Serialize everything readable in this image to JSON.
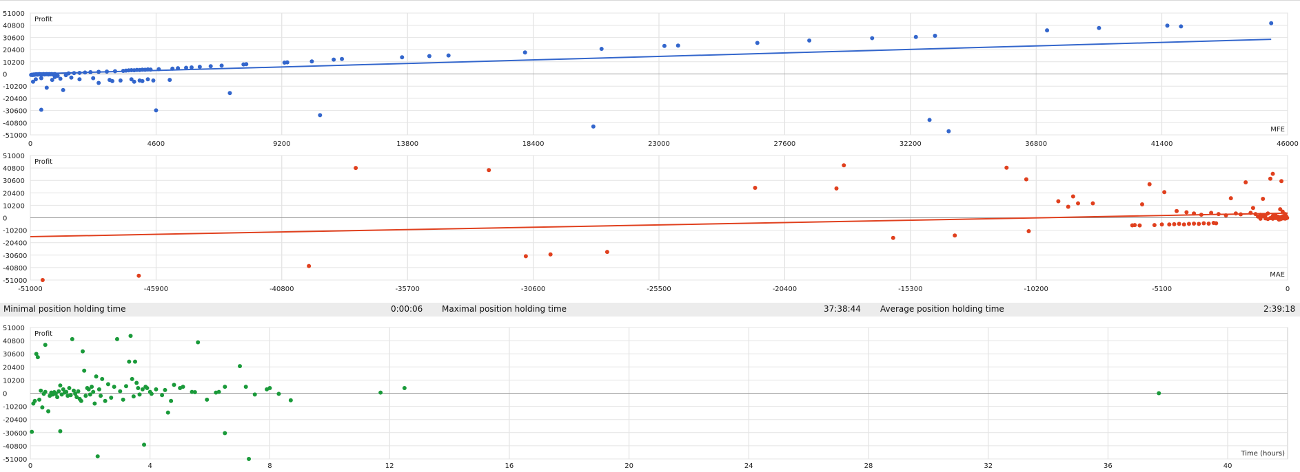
{
  "chart_data": [
    {
      "type": "scatter",
      "ylabel": "Profit",
      "xlabel": "MFE",
      "color": "#3366cc",
      "xlim": [
        0,
        46000
      ],
      "ylim": [
        -51000,
        51000
      ],
      "xticks": [
        0,
        4600,
        9200,
        13800,
        18400,
        23000,
        27600,
        32200,
        36800,
        41400,
        46000
      ],
      "yticks": [
        51000,
        40800,
        30600,
        20400,
        10200,
        0,
        -10200,
        -20400,
        -30600,
        -40800,
        -51000
      ],
      "grid": true,
      "trendline": {
        "x": [
          0,
          45400
        ],
        "y": [
          0,
          29000
        ]
      },
      "points": [
        [
          30,
          -800
        ],
        [
          60,
          -600
        ],
        [
          90,
          -900
        ],
        [
          120,
          -400
        ],
        [
          150,
          -700
        ],
        [
          180,
          -300
        ],
        [
          210,
          -500
        ],
        [
          240,
          -200
        ],
        [
          270,
          -600
        ],
        [
          300,
          -300
        ],
        [
          330,
          -100
        ],
        [
          360,
          -400
        ],
        [
          390,
          -200
        ],
        [
          420,
          -500
        ],
        [
          450,
          -300
        ],
        [
          480,
          -100
        ],
        [
          510,
          -400
        ],
        [
          540,
          -200
        ],
        [
          570,
          -300
        ],
        [
          600,
          -100
        ],
        [
          630,
          -200
        ],
        [
          660,
          -400
        ],
        [
          690,
          -100
        ],
        [
          720,
          -300
        ],
        [
          750,
          -200
        ],
        [
          780,
          -100
        ],
        [
          810,
          -300
        ],
        [
          840,
          -500
        ],
        [
          870,
          -200
        ],
        [
          900,
          -100
        ],
        [
          100,
          -6500
        ],
        [
          200,
          -4500
        ],
        [
          400,
          -3500
        ],
        [
          600,
          -11500
        ],
        [
          800,
          -5000
        ],
        [
          900,
          -2500
        ],
        [
          1000,
          -1500
        ],
        [
          1100,
          -4000
        ],
        [
          1200,
          -13500
        ],
        [
          1300,
          -1000
        ],
        [
          400,
          -30000
        ],
        [
          1400,
          500
        ],
        [
          1600,
          700
        ],
        [
          1800,
          900
        ],
        [
          2000,
          1200
        ],
        [
          2200,
          1500
        ],
        [
          2500,
          1800
        ],
        [
          2800,
          2000
        ],
        [
          3100,
          2300
        ],
        [
          3400,
          2600
        ],
        [
          1500,
          -3000
        ],
        [
          1800,
          -4500
        ],
        [
          2300,
          -3500
        ],
        [
          2500,
          -7500
        ],
        [
          2900,
          -5000
        ],
        [
          3000,
          -6000
        ],
        [
          3300,
          -5500
        ],
        [
          3700,
          -4500
        ],
        [
          3800,
          -6500
        ],
        [
          4000,
          -5500
        ],
        [
          3500,
          2800
        ],
        [
          3600,
          3000
        ],
        [
          3700,
          3200
        ],
        [
          3800,
          3100
        ],
        [
          3900,
          3400
        ],
        [
          4000,
          3300
        ],
        [
          4100,
          3600
        ],
        [
          4200,
          3500
        ],
        [
          4300,
          3800
        ],
        [
          4400,
          3700
        ],
        [
          4100,
          -6000
        ],
        [
          4300,
          -4500
        ],
        [
          4500,
          -5500
        ],
        [
          4600,
          -30500
        ],
        [
          4700,
          4000
        ],
        [
          5100,
          -5000
        ],
        [
          5200,
          4500
        ],
        [
          5400,
          4800
        ],
        [
          5700,
          5200
        ],
        [
          5900,
          5500
        ],
        [
          6200,
          6000
        ],
        [
          6600,
          6500
        ],
        [
          7000,
          7000
        ],
        [
          7300,
          -16000
        ],
        [
          7800,
          8000
        ],
        [
          7900,
          8200
        ],
        [
          9300,
          9500
        ],
        [
          9400,
          9700
        ],
        [
          10300,
          10500
        ],
        [
          10600,
          -34500
        ],
        [
          11100,
          12000
        ],
        [
          11400,
          12500
        ],
        [
          13600,
          14000
        ],
        [
          14600,
          15000
        ],
        [
          15300,
          15500
        ],
        [
          18100,
          18000
        ],
        [
          20600,
          -44000
        ],
        [
          20900,
          21000
        ],
        [
          23200,
          23500
        ],
        [
          23700,
          23800
        ],
        [
          26600,
          26000
        ],
        [
          28500,
          28000
        ],
        [
          30800,
          30000
        ],
        [
          32400,
          31000
        ],
        [
          32900,
          -38500
        ],
        [
          33100,
          32000
        ],
        [
          33600,
          -48000
        ],
        [
          37200,
          36500
        ],
        [
          39100,
          38500
        ],
        [
          41600,
          40500
        ],
        [
          42100,
          39800
        ],
        [
          45400,
          42500
        ]
      ]
    },
    {
      "type": "scatter",
      "ylabel": "Profit",
      "xlabel": "MAE",
      "color": "#e0401e",
      "xlim": [
        -51000,
        0
      ],
      "ylim": [
        -51000,
        51000
      ],
      "xticks": [
        -51000,
        -45900,
        -40800,
        -35700,
        -30600,
        -25500,
        -20400,
        -15300,
        -10200,
        -5100,
        0
      ],
      "yticks": [
        51000,
        40800,
        30600,
        20400,
        10200,
        0,
        -10200,
        -20400,
        -30600,
        -40800,
        -51000
      ],
      "grid": true,
      "trendline": {
        "x": [
          -51000,
          0
        ],
        "y": [
          -15500,
          3800
        ]
      },
      "points": [
        [
          -50500,
          -51000
        ],
        [
          -46600,
          -47500
        ],
        [
          -39700,
          -39500
        ],
        [
          -37800,
          40800
        ],
        [
          -32400,
          39000
        ],
        [
          -30900,
          -31500
        ],
        [
          -29900,
          -30000
        ],
        [
          -27600,
          -28000
        ],
        [
          -21600,
          24500
        ],
        [
          -18300,
          24000
        ],
        [
          -18000,
          43000
        ],
        [
          -16000,
          -16500
        ],
        [
          -13500,
          -14500
        ],
        [
          -11400,
          41000
        ],
        [
          -10600,
          31500
        ],
        [
          -10500,
          -11000
        ],
        [
          -9300,
          13500
        ],
        [
          -8900,
          9000
        ],
        [
          -8700,
          17500
        ],
        [
          -8500,
          11800
        ],
        [
          -7900,
          11800
        ],
        [
          -6300,
          -6200
        ],
        [
          -6200,
          -6000
        ],
        [
          -6000,
          -6300
        ],
        [
          -5900,
          11000
        ],
        [
          -5600,
          27500
        ],
        [
          -5400,
          -6000
        ],
        [
          -5100,
          -5500
        ],
        [
          -5000,
          21000
        ],
        [
          -4800,
          -5500
        ],
        [
          -4600,
          -5300
        ],
        [
          -4400,
          -5000
        ],
        [
          -4200,
          -5500
        ],
        [
          -4000,
          -5000
        ],
        [
          -3800,
          -4800
        ],
        [
          -3600,
          -5000
        ],
        [
          -3400,
          -4500
        ],
        [
          -3200,
          -4800
        ],
        [
          -3000,
          -4200
        ],
        [
          -2900,
          -4500
        ],
        [
          -4500,
          5500
        ],
        [
          -4100,
          4500
        ],
        [
          -3800,
          3500
        ],
        [
          -3500,
          2500
        ],
        [
          -3100,
          4000
        ],
        [
          -2800,
          3000
        ],
        [
          -2500,
          2000
        ],
        [
          -2300,
          16000
        ],
        [
          -2100,
          3500
        ],
        [
          -1900,
          2800
        ],
        [
          -1700,
          29000
        ],
        [
          -1500,
          4000
        ],
        [
          -1300,
          3000
        ],
        [
          -1100,
          2500
        ],
        [
          -1000,
          15500
        ],
        [
          -900,
          2000
        ],
        [
          -800,
          3500
        ],
        [
          -700,
          32000
        ],
        [
          -600,
          1500
        ],
        [
          -500,
          2500
        ],
        [
          -400,
          1000
        ],
        [
          -350,
          -1500
        ],
        [
          -300,
          500
        ],
        [
          -250,
          -800
        ],
        [
          -200,
          1200
        ],
        [
          -150,
          -500
        ],
        [
          -100,
          800
        ],
        [
          -50,
          -200
        ],
        [
          -900,
          -500
        ],
        [
          -800,
          -1000
        ],
        [
          -700,
          -300
        ],
        [
          -600,
          -800
        ],
        [
          -500,
          -200
        ],
        [
          -400,
          -600
        ],
        [
          -300,
          -1200
        ],
        [
          -200,
          -300
        ],
        [
          -150,
          400
        ],
        [
          -100,
          -700
        ],
        [
          -80,
          200
        ],
        [
          -60,
          -400
        ],
        [
          -40,
          300
        ],
        [
          -20,
          -100
        ],
        [
          -1200,
          1000
        ],
        [
          -1100,
          -800
        ],
        [
          -1000,
          1500
        ],
        [
          -600,
          36000
        ],
        [
          -300,
          7000
        ],
        [
          -200,
          5000
        ],
        [
          -100,
          3000
        ],
        [
          -50,
          1000
        ],
        [
          -250,
          30000
        ],
        [
          -1400,
          8000
        ]
      ]
    },
    {
      "type": "scatter",
      "ylabel": "Profit",
      "xlabel": "Time (hours)",
      "color": "#1a9a3a",
      "xlim": [
        0,
        42
      ],
      "ylim": [
        -51000,
        51000
      ],
      "xticks": [
        0,
        4,
        8,
        12,
        16,
        20,
        24,
        28,
        32,
        36,
        40
      ],
      "yticks": [
        51000,
        40800,
        30600,
        20400,
        10200,
        0,
        -10200,
        -20400,
        -30600,
        -40800,
        -51000
      ],
      "grid": true,
      "points": [
        [
          0.05,
          -30000
        ],
        [
          0.1,
          -8000
        ],
        [
          0.15,
          -6000
        ],
        [
          0.2,
          30500
        ],
        [
          0.25,
          28000
        ],
        [
          0.3,
          -5000
        ],
        [
          0.35,
          2000
        ],
        [
          0.4,
          -11000
        ],
        [
          0.45,
          -500
        ],
        [
          0.5,
          37500
        ],
        [
          0.5,
          1000
        ],
        [
          0.6,
          -14000
        ],
        [
          0.65,
          -2000
        ],
        [
          0.7,
          500
        ],
        [
          0.75,
          -1000
        ],
        [
          0.8,
          800
        ],
        [
          0.85,
          -500
        ],
        [
          0.9,
          -3000
        ],
        [
          0.95,
          1500
        ],
        [
          1.0,
          -29500
        ],
        [
          1.0,
          6000
        ],
        [
          1.05,
          -1000
        ],
        [
          1.1,
          3000
        ],
        [
          1.15,
          500
        ],
        [
          1.2,
          1000
        ],
        [
          1.25,
          -2000
        ],
        [
          1.3,
          4000
        ],
        [
          1.35,
          -1500
        ],
        [
          1.4,
          42000
        ],
        [
          1.45,
          2000
        ],
        [
          1.5,
          -500
        ],
        [
          1.55,
          -3000
        ],
        [
          1.6,
          1500
        ],
        [
          1.65,
          -4500
        ],
        [
          1.7,
          -6000
        ],
        [
          1.75,
          32500
        ],
        [
          1.8,
          17500
        ],
        [
          1.85,
          -2000
        ],
        [
          1.9,
          4000
        ],
        [
          1.95,
          3000
        ],
        [
          2.0,
          -1000
        ],
        [
          2.05,
          5000
        ],
        [
          2.1,
          1000
        ],
        [
          2.15,
          -8000
        ],
        [
          2.2,
          13000
        ],
        [
          2.25,
          -49000
        ],
        [
          2.3,
          3000
        ],
        [
          2.35,
          -2000
        ],
        [
          2.4,
          11000
        ],
        [
          2.5,
          -6000
        ],
        [
          2.6,
          7000
        ],
        [
          2.7,
          -3500
        ],
        [
          2.8,
          5000
        ],
        [
          2.9,
          42000
        ],
        [
          3.0,
          1500
        ],
        [
          3.1,
          -5000
        ],
        [
          3.2,
          5500
        ],
        [
          3.3,
          24500
        ],
        [
          3.35,
          44500
        ],
        [
          3.4,
          11000
        ],
        [
          3.45,
          -2500
        ],
        [
          3.5,
          24500
        ],
        [
          3.55,
          8000
        ],
        [
          3.6,
          4000
        ],
        [
          3.65,
          -1000
        ],
        [
          3.75,
          3000
        ],
        [
          3.8,
          -40000
        ],
        [
          3.85,
          5000
        ],
        [
          3.9,
          4000
        ],
        [
          4.0,
          1000
        ],
        [
          4.05,
          -500
        ],
        [
          4.2,
          3000
        ],
        [
          4.4,
          -1500
        ],
        [
          4.5,
          2500
        ],
        [
          4.6,
          -15000
        ],
        [
          4.7,
          -6000
        ],
        [
          4.8,
          6500
        ],
        [
          5.0,
          4000
        ],
        [
          5.1,
          5000
        ],
        [
          5.4,
          1000
        ],
        [
          5.5,
          800
        ],
        [
          5.6,
          39500
        ],
        [
          5.9,
          -5000
        ],
        [
          6.2,
          500
        ],
        [
          6.3,
          1000
        ],
        [
          6.5,
          -31000
        ],
        [
          6.5,
          5000
        ],
        [
          7.0,
          21000
        ],
        [
          7.2,
          5000
        ],
        [
          7.3,
          -51000
        ],
        [
          7.5,
          -1000
        ],
        [
          7.9,
          3000
        ],
        [
          8.0,
          4000
        ],
        [
          8.3,
          -500
        ],
        [
          8.7,
          -5500
        ],
        [
          11.7,
          500
        ],
        [
          12.5,
          4000
        ],
        [
          37.7,
          0
        ]
      ]
    }
  ],
  "info_bar": {
    "min_label": "Minimal position holding time",
    "min_value": "0:00:06",
    "max_label": "Maximal position holding time",
    "max_value": "37:38:44",
    "avg_label": "Average position holding time",
    "avg_value": "2:39:18"
  }
}
